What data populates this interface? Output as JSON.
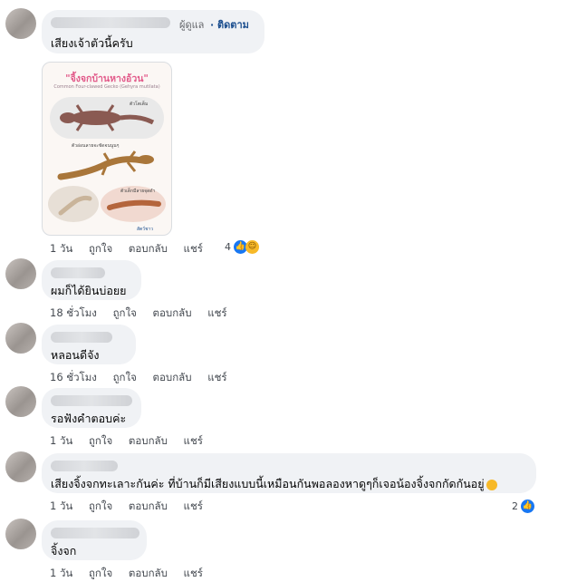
{
  "labels": {
    "like": "ถูกใจ",
    "reply": "ตอบกลับ",
    "share": "แชร์"
  },
  "comments": [
    {
      "text": "เสียงเจ้าตัวนี้ครับ",
      "role": "ผู้ดูแล",
      "follow": "· ติดตาม",
      "time": "1 วัน",
      "reaction_count": "4"
    },
    {
      "text": "ผมก็ได้ยินบ่อยย",
      "time": "18 ชั่วโมง"
    },
    {
      "text": "หลอนดีจัง",
      "time": "16 ชั่วโมง"
    },
    {
      "text": "รอฟังคำตอบค่ะ",
      "time": "1 วัน"
    },
    {
      "text": "เสียงจิ้งจกทะเลาะกันค่ะ ที่บ้านก็มีเสียงแบบนี้เหมือนกันพอลองหาดูๆก็เจอน้องจิ้งจกกัดกันอยู่",
      "time": "1 วัน",
      "reaction_count": "2"
    },
    {
      "text": "จิ้งจก",
      "time": "1 วัน"
    }
  ],
  "infographic": {
    "title": "\"จิ้งจกบ้านหางอ้วน\"",
    "subtitle": "Common Four-clawed Gecko (Gehyra mutilata)",
    "label_top": "ตัวโตเต็ม",
    "label_middle": "ตัวอ่อนลายจะชัดจนนูนๆ",
    "label_bottom": "ตัวเด็กมีลายจุดดำ",
    "footer": "สัตว์ชาว",
    "colors": {
      "title": "#e25a8a",
      "skin": "#8a5a52",
      "juvenile": "#a9763a"
    }
  },
  "icons": {
    "like": "thumbs-up-icon",
    "care": "care-emoji-icon",
    "haha": "haha-emoji-icon"
  }
}
